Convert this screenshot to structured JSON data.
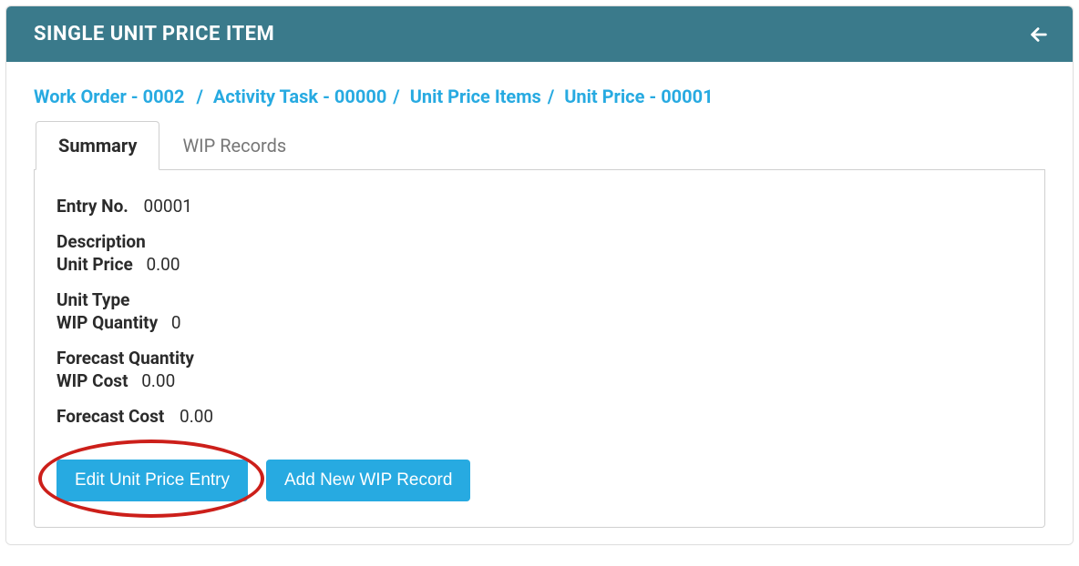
{
  "header": {
    "title": "SINGLE UNIT PRICE ITEM"
  },
  "breadcrumb": {
    "items": [
      "Work Order - 0002",
      "Activity Task - 00000",
      "Unit Price Items",
      "Unit Price - 00001"
    ],
    "sep": "/"
  },
  "tabs": {
    "summary_label": "Summary",
    "wip_records_label": "WIP Records"
  },
  "summary": {
    "entry_no_label": "Entry No.",
    "entry_no_value": "00001",
    "description_label": "Description",
    "unit_price_label": "Unit Price",
    "unit_price_value": "0.00",
    "unit_type_label": "Unit Type",
    "wip_quantity_label": "WIP Quantity",
    "wip_quantity_value": "0",
    "forecast_quantity_label": "Forecast Quantity",
    "wip_cost_label": "WIP Cost",
    "wip_cost_value": "0.00",
    "forecast_cost_label": "Forecast Cost",
    "forecast_cost_value": "0.00"
  },
  "buttons": {
    "edit_label": "Edit Unit Price Entry",
    "add_wip_label": "Add New WIP Record"
  }
}
